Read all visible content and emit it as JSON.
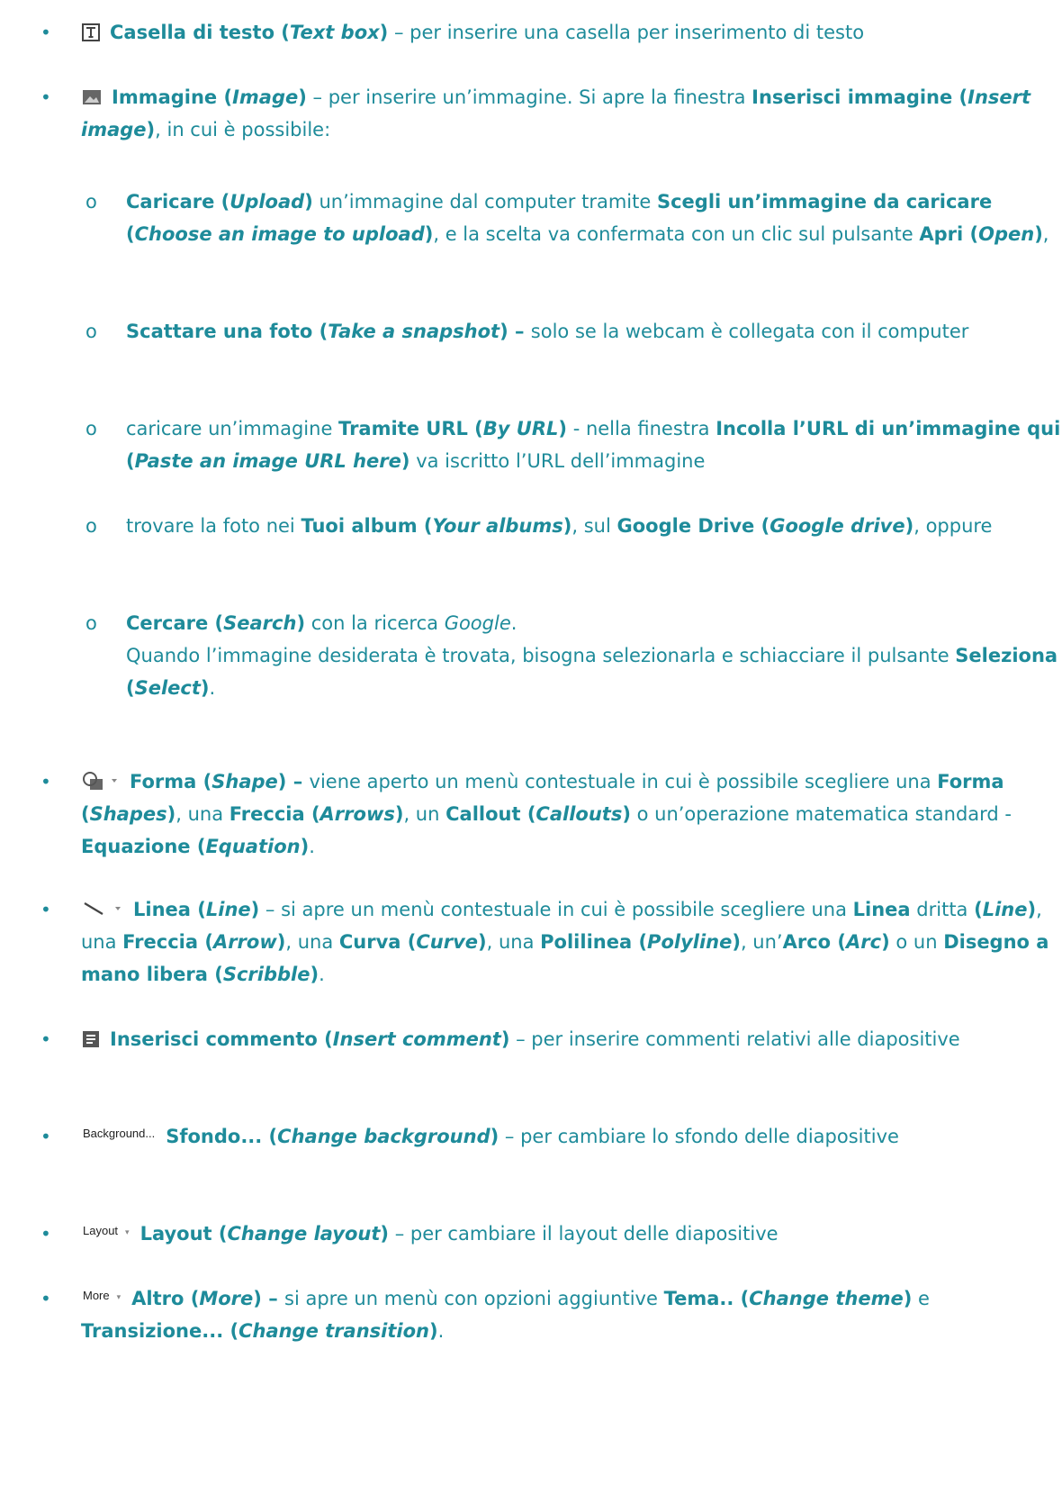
{
  "colors": {
    "text": "#1e8b9a",
    "icon": "#444444"
  },
  "items": [
    {
      "level": 1,
      "bullet": "•",
      "icon": "text-box-icon",
      "segments": [
        {
          "text": "Casella di testo (",
          "style": "b"
        },
        {
          "text": "Text box",
          "style": "bi"
        },
        {
          "text": ")",
          "style": "b"
        },
        {
          "text": " – per inserire una casella per inserimento di testo",
          "style": ""
        }
      ]
    },
    {
      "level": 1,
      "bullet": "•",
      "icon": "image-icon",
      "segments": [
        {
          "text": "Immagine (",
          "style": "b"
        },
        {
          "text": "Image",
          "style": "bi"
        },
        {
          "text": ")",
          "style": "b"
        },
        {
          "text": " – per inserire un’immagine. Si apre la finestra ",
          "style": ""
        },
        {
          "text": "Inserisci immagine (",
          "style": "b"
        },
        {
          "text": "Insert image",
          "style": "bi"
        },
        {
          "text": ")",
          "style": "b"
        },
        {
          "text": ", in cui è possibile:",
          "style": ""
        }
      ]
    },
    {
      "level": 2,
      "bullet": "o",
      "segments": [
        {
          "text": "Caricare (",
          "style": "b"
        },
        {
          "text": "Upload",
          "style": "bi"
        },
        {
          "text": ")",
          "style": "b"
        },
        {
          "text": " un’immagine dal computer tramite ",
          "style": ""
        },
        {
          "text": "Scegli un’immagine da caricare (",
          "style": "b"
        },
        {
          "text": "Choose an image to upload",
          "style": "bi"
        },
        {
          "text": ")",
          "style": "b"
        },
        {
          "text": ", e la scelta va confermata con un clic sul pulsante ",
          "style": ""
        },
        {
          "text": "Apri (",
          "style": "b"
        },
        {
          "text": "Open",
          "style": "bi"
        },
        {
          "text": ")",
          "style": "b"
        },
        {
          "text": ",",
          "style": ""
        }
      ]
    },
    {
      "level": 2,
      "bullet": "o",
      "segments": [
        {
          "text": "Scattare una foto (",
          "style": "b"
        },
        {
          "text": "Take a snapshot",
          "style": "bi"
        },
        {
          "text": ") – ",
          "style": "b"
        },
        {
          "text": "solo se la webcam è collegata con il computer",
          "style": ""
        }
      ]
    },
    {
      "level": 2,
      "bullet": "o",
      "segments": [
        {
          "text": "caricare un’immagine ",
          "style": ""
        },
        {
          "text": "Tramite URL (",
          "style": "b"
        },
        {
          "text": "By URL",
          "style": "bi"
        },
        {
          "text": ")",
          "style": "b"
        },
        {
          "text": " - nella finestra ",
          "style": ""
        },
        {
          "text": "Incolla l’URL di un’immagine qui (",
          "style": "b"
        },
        {
          "text": "Paste an image URL here",
          "style": "bi"
        },
        {
          "text": ")",
          "style": "b"
        },
        {
          "text": " va iscritto l’URL dell’immagine",
          "style": ""
        }
      ]
    },
    {
      "level": 2,
      "bullet": "o",
      "segments": [
        {
          "text": "trovare la foto nei ",
          "style": ""
        },
        {
          "text": "Tuoi album (",
          "style": "b"
        },
        {
          "text": "Your albums",
          "style": "bi"
        },
        {
          "text": ")",
          "style": "b"
        },
        {
          "text": ", sul ",
          "style": ""
        },
        {
          "text": "Google Drive (",
          "style": "b"
        },
        {
          "text": "Google drive",
          "style": "bi"
        },
        {
          "text": ")",
          "style": "b"
        },
        {
          "text": ", oppure",
          "style": ""
        }
      ]
    },
    {
      "level": 2,
      "bullet": "o",
      "segments": [
        {
          "text": "Cercare (",
          "style": "b"
        },
        {
          "text": "Search",
          "style": "bi"
        },
        {
          "text": ")",
          "style": "b"
        },
        {
          "text": " con la ricerca ",
          "style": ""
        },
        {
          "text": "Google",
          "style": "i"
        },
        {
          "text": ".",
          "style": ""
        },
        {
          "text": "",
          "style": "br"
        },
        {
          "text": "Quando l’immagine desiderata è trovata, bisogna selezionarla e schiacciare il pulsante ",
          "style": ""
        },
        {
          "text": "Seleziona (",
          "style": "b"
        },
        {
          "text": "Select",
          "style": "bi"
        },
        {
          "text": ")",
          "style": "b"
        },
        {
          "text": ".",
          "style": ""
        }
      ]
    },
    {
      "level": 1,
      "bullet": "•",
      "icon": "shape-icon",
      "segments": [
        {
          "text": "Forma (",
          "style": "b"
        },
        {
          "text": "Shape",
          "style": "bi"
        },
        {
          "text": ") – ",
          "style": "b"
        },
        {
          "text": "viene aperto un menù contestuale in cui è possibile scegliere una ",
          "style": ""
        },
        {
          "text": "Forma (",
          "style": "b"
        },
        {
          "text": "Shapes",
          "style": "bi"
        },
        {
          "text": ")",
          "style": "b"
        },
        {
          "text": ", una ",
          "style": ""
        },
        {
          "text": "Freccia (",
          "style": "b"
        },
        {
          "text": "Arrows",
          "style": "bi"
        },
        {
          "text": ")",
          "style": "b"
        },
        {
          "text": ", un ",
          "style": ""
        },
        {
          "text": "Callout (",
          "style": "b"
        },
        {
          "text": "Callouts",
          "style": "bi"
        },
        {
          "text": ")",
          "style": "b"
        },
        {
          "text": " o un’operazione matematica standard - ",
          "style": ""
        },
        {
          "text": "Equazione (",
          "style": "b"
        },
        {
          "text": "Equation",
          "style": "bi"
        },
        {
          "text": ")",
          "style": "b"
        },
        {
          "text": ".",
          "style": ""
        }
      ]
    },
    {
      "level": 1,
      "bullet": "•",
      "icon": "line-icon",
      "segments": [
        {
          "text": "Linea (",
          "style": "b"
        },
        {
          "text": "Line",
          "style": "bi"
        },
        {
          "text": ")",
          "style": "b"
        },
        {
          "text": " – si apre un menù contestuale in cui è possibile scegliere una ",
          "style": ""
        },
        {
          "text": "Linea",
          "style": "b"
        },
        {
          "text": " dritta ",
          "style": ""
        },
        {
          "text": "(",
          "style": "b"
        },
        {
          "text": "Line",
          "style": "bi"
        },
        {
          "text": ")",
          "style": "b"
        },
        {
          "text": ", una ",
          "style": ""
        },
        {
          "text": "Freccia (",
          "style": "b"
        },
        {
          "text": "Arrow",
          "style": "bi"
        },
        {
          "text": ")",
          "style": "b"
        },
        {
          "text": ", una ",
          "style": ""
        },
        {
          "text": "Curva (",
          "style": "b"
        },
        {
          "text": "Curve",
          "style": "bi"
        },
        {
          "text": ")",
          "style": "b"
        },
        {
          "text": ", una ",
          "style": ""
        },
        {
          "text": "Polilinea (",
          "style": "b"
        },
        {
          "text": "Polyline",
          "style": "bi"
        },
        {
          "text": ")",
          "style": "b"
        },
        {
          "text": ", un’",
          "style": ""
        },
        {
          "text": "Arco (",
          "style": "b"
        },
        {
          "text": "Arc",
          "style": "bi"
        },
        {
          "text": ")",
          "style": "b"
        },
        {
          "text": " o un ",
          "style": ""
        },
        {
          "text": "Disegno a mano libera (",
          "style": "b"
        },
        {
          "text": "Scribble",
          "style": "bi"
        },
        {
          "text": ")",
          "style": "b"
        },
        {
          "text": ".",
          "style": ""
        }
      ]
    },
    {
      "level": 1,
      "bullet": "•",
      "icon": "comment-icon",
      "segments": [
        {
          "text": "Inserisci commento (",
          "style": "b"
        },
        {
          "text": "Insert comment",
          "style": "bi"
        },
        {
          "text": ")",
          "style": "b"
        },
        {
          "text": " – per inserire commenti relativi alle diapositive",
          "style": ""
        }
      ]
    },
    {
      "level": 1,
      "bullet": "•",
      "button_label": "Background...",
      "segments": [
        {
          "text": "Sfondo... (",
          "style": "b"
        },
        {
          "text": "Change background",
          "style": "bi"
        },
        {
          "text": ")",
          "style": "b"
        },
        {
          "text": " – per cambiare lo sfondo delle diapositive",
          "style": ""
        }
      ]
    },
    {
      "level": 1,
      "bullet": "•",
      "button_label": "Layout",
      "button_caret": "▾",
      "segments": [
        {
          "text": "Layout (",
          "style": "b"
        },
        {
          "text": "Change layout",
          "style": "bi"
        },
        {
          "text": ")",
          "style": "b"
        },
        {
          "text": " – per cambiare il layout delle diapositive",
          "style": ""
        }
      ]
    },
    {
      "level": 1,
      "bullet": "•",
      "button_label": "More",
      "button_caret": "▾",
      "segments": [
        {
          "text": "Altro (",
          "style": "b"
        },
        {
          "text": "More",
          "style": "bi"
        },
        {
          "text": ") – ",
          "style": "b"
        },
        {
          "text": "si apre un menù con opzioni aggiuntive ",
          "style": ""
        },
        {
          "text": "Tema.. (",
          "style": "b"
        },
        {
          "text": "Change theme",
          "style": "bi"
        },
        {
          "text": ")",
          "style": "b"
        },
        {
          "text": " e ",
          "style": ""
        },
        {
          "text": "Transizione... (",
          "style": "b"
        },
        {
          "text": "Change transition",
          "style": "bi"
        },
        {
          "text": ")",
          "style": "b"
        },
        {
          "text": ".",
          "style": ""
        }
      ]
    }
  ]
}
